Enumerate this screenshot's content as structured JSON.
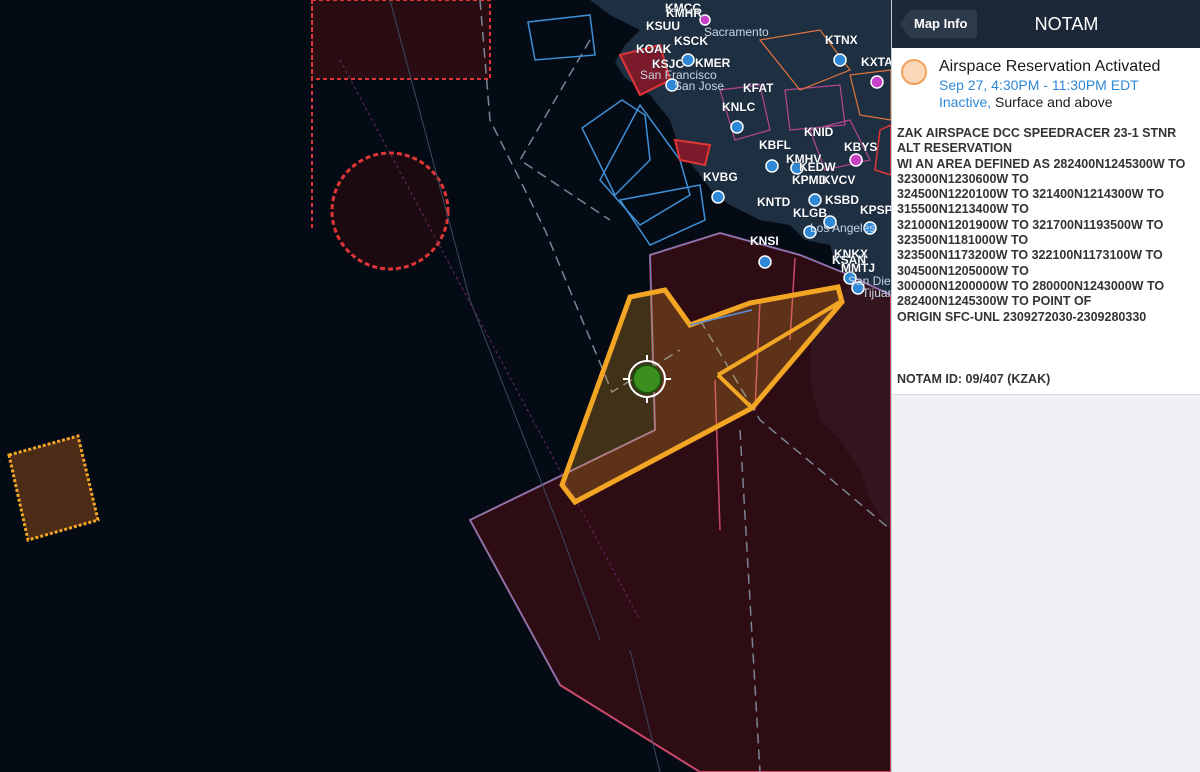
{
  "panel": {
    "back_label": "Map Info",
    "title": "NOTAM",
    "notam": {
      "title": "Airspace Reservation Activated",
      "time": "Sep 27, 4:30PM - 11:30PM EDT",
      "status_inactive": "Inactive,",
      "status_range": " Surface and above",
      "body": "ZAK AIRSPACE DCC SPEEDRACER 23-1 STNR ALT RESERVATION\nWI AN AREA DEFINED AS 282400N1245300W TO 323000N1230600W TO\n324500N1220100W TO 321400N1214300W TO 315500N1213400W TO\n321000N1201900W TO 321700N1193500W TO 323500N1181000W TO\n323500N1173200W TO 322100N1173100W TO 304500N1205000W TO\n300000N1200000W TO 280000N1243000W TO 282400N1245300W TO POINT OF\nORIGIN SFC-UNL 2309272030-2309280330",
      "id": "NOTAM ID: 09/407 (KZAK)",
      "status_color": "#f3a15a"
    }
  },
  "map": {
    "airports": [
      {
        "code": "KMCC"
      },
      {
        "code": "KMHR"
      },
      {
        "code": "KSUU"
      },
      {
        "code": "KSCK"
      },
      {
        "code": "KOAK"
      },
      {
        "code": "KSJC"
      },
      {
        "code": "KMER"
      },
      {
        "code": "KFAT"
      },
      {
        "code": "KTNX"
      },
      {
        "code": "KXTA"
      },
      {
        "code": "KNLC"
      },
      {
        "code": "KNID"
      },
      {
        "code": "KBFL"
      },
      {
        "code": "KBYS"
      },
      {
        "code": "KMHV"
      },
      {
        "code": "KEDW"
      },
      {
        "code": "KPMD"
      },
      {
        "code": "KVCV"
      },
      {
        "code": "KVBG"
      },
      {
        "code": "KNTD"
      },
      {
        "code": "KLGB"
      },
      {
        "code": "KSBD"
      },
      {
        "code": "KPSP"
      },
      {
        "code": "KNSI"
      },
      {
        "code": "KNKX"
      },
      {
        "code": "KSAN"
      },
      {
        "code": "MMTJ"
      }
    ],
    "cities": [
      "Sacramento",
      "San Francisco",
      "San Jose",
      "Los Angeles",
      "San Diego",
      "Tijuana"
    ]
  }
}
